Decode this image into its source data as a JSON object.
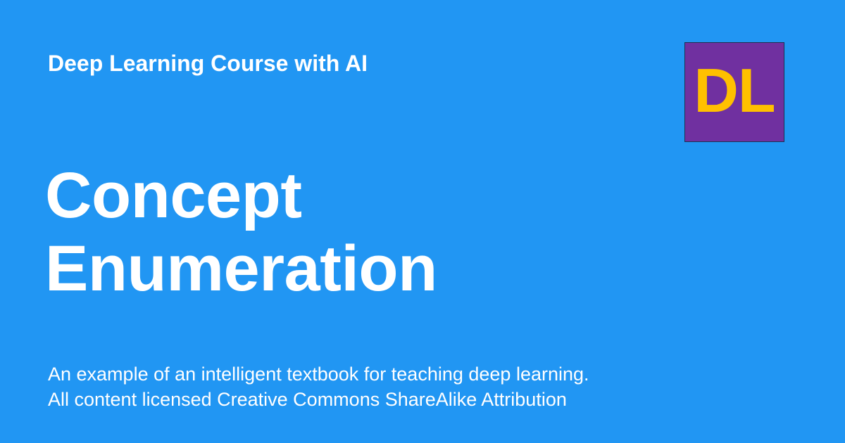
{
  "site": {
    "name": "Deep Learning Course with AI"
  },
  "page": {
    "title_lines": [
      "Concept",
      "Enumeration"
    ]
  },
  "logo": {
    "text": "DL",
    "background_color": "#7030a0",
    "text_color": "#ffc000"
  },
  "description": {
    "lines": [
      "An example of an intelligent textbook for teaching deep learning.",
      "All content licensed Creative Commons ShareAlike Attribution"
    ]
  },
  "colors": {
    "background": "#2196f3",
    "text": "#ffffff"
  }
}
